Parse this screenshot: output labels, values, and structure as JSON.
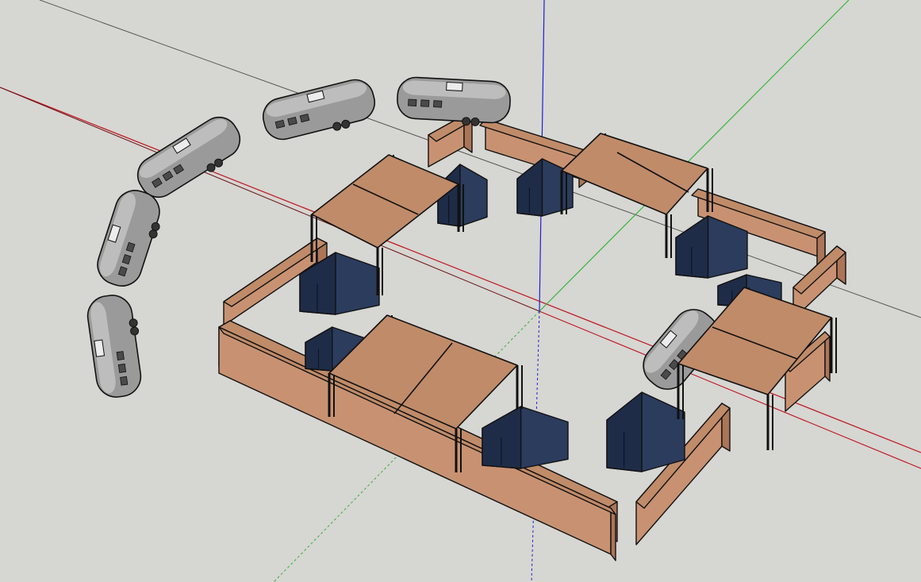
{
  "scene": {
    "type": "3d-modeling-viewport",
    "colors": {
      "background": "#d6d6d2",
      "axis_red": "#c0121c",
      "axis_green": "#2fb52f",
      "axis_blue": "#1d1fd6",
      "wood": "#c89272",
      "wood_top": "#c08b69",
      "wood_dark": "#ac7558",
      "tent": "#2b3c5d",
      "tent_dark": "#1f2c47",
      "trailer": "#9a9a9a",
      "trailer_light": "#bdbdbd",
      "outline": "#111111"
    },
    "objects": {
      "trailers": 6,
      "tents": 8,
      "platforms": 4,
      "shelving_walls": 10
    }
  }
}
